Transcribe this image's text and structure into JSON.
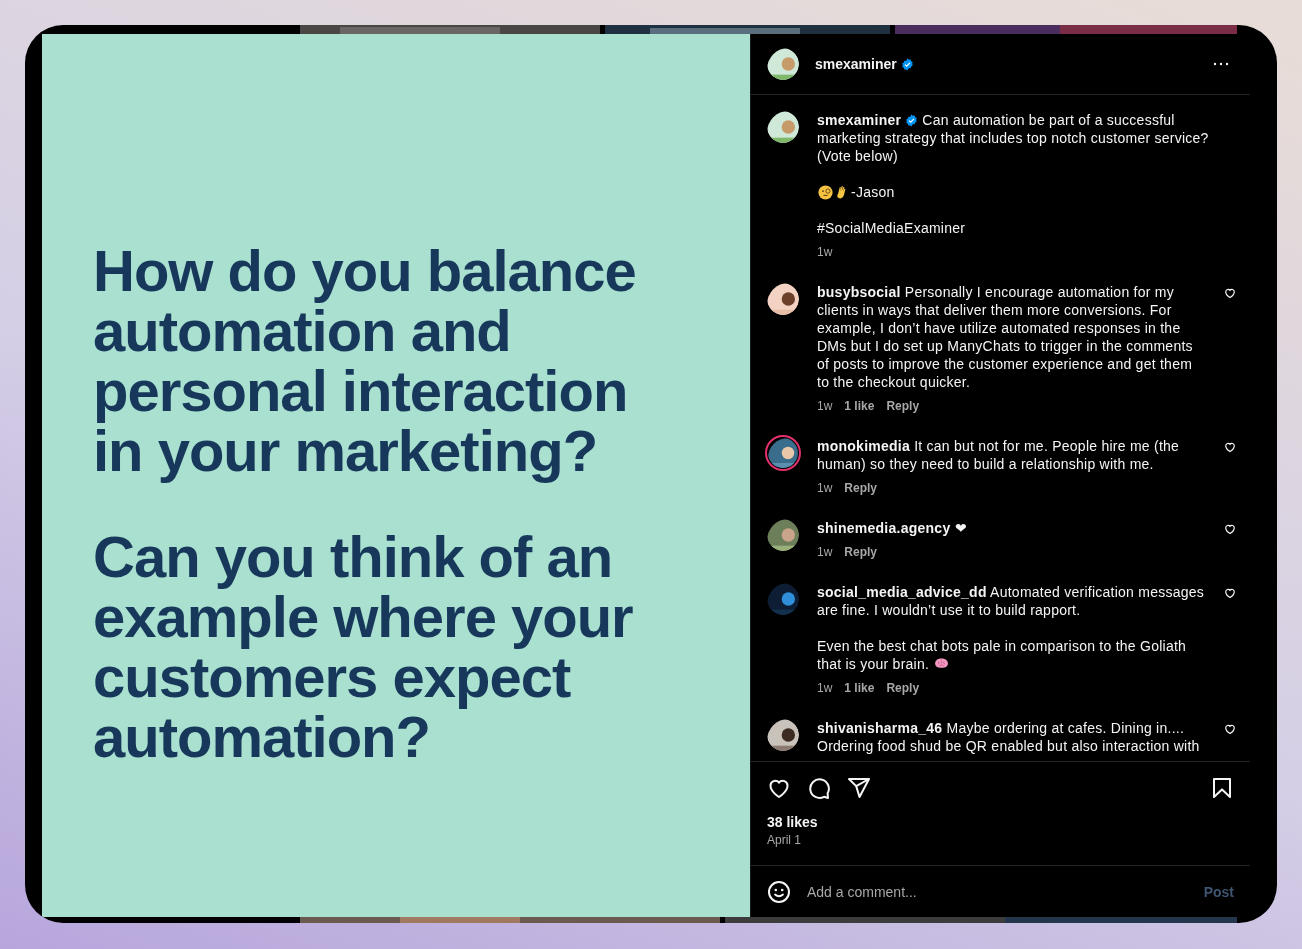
{
  "post_image": {
    "paragraphs": [
      {
        "lines": [
          "How do you balance",
          "automation and",
          "personal interaction",
          "in your marketing?"
        ]
      },
      {
        "lines": [
          "Can you think of an",
          "example where your",
          "customers expect",
          "automation?"
        ]
      }
    ]
  },
  "header": {
    "username": "smexaminer",
    "verified": true
  },
  "caption": {
    "username": "smexaminer",
    "verified": true,
    "text": "Can automation be part of a successful marketing strategy that includes top notch customer service? (Vote below)",
    "signature": "-Jason",
    "hashtag": "#SocialMediaExaminer",
    "time": "1w"
  },
  "comments": [
    {
      "username": "busybsocial",
      "paragraphs": [
        "Personally I encourage automation for my clients in ways that deliver them more conversions. For example, I don’t have utilize automated responses in the DMs but I do set up ManyChats to trigger in the comments of posts to improve the customer experience and get them to the checkout quicker."
      ],
      "time": "1w",
      "likes": "1 like",
      "reply": "Reply",
      "liked": false,
      "has_story": false
    },
    {
      "username": "monokimedia",
      "paragraphs": [
        "It can but not for me. People hire me (the human) so they need to build a relationship with me."
      ],
      "time": "1w",
      "reply": "Reply",
      "liked": false,
      "has_story": true
    },
    {
      "username": "shinemedia.agency",
      "paragraphs": [
        "❤"
      ],
      "time": "1w",
      "reply": "Reply",
      "liked": false,
      "has_story": false
    },
    {
      "username": "social_media_advice_dd",
      "paragraphs": [
        "Automated verification messages are fine. I wouldn’t use it to build rapport.",
        "Even the best chat bots pale in comparison to the Goliath that is your brain."
      ],
      "kind": "text_emoji",
      "time": "1w",
      "likes": "1 like",
      "reply": "Reply",
      "liked": false,
      "has_story": false
    },
    {
      "username": "shivanisharma_46",
      "paragraphs": [
        "Maybe ordering at cafes. Dining in.... Ordering food shud be QR enabled but also interaction with"
      ],
      "liked": false,
      "has_story": false
    }
  ],
  "actions": {
    "liked": false,
    "saved": false,
    "likes": "38 likes",
    "date": "April 1"
  },
  "comment_box": {
    "placeholder": "Add a comment...",
    "post_label": "Post",
    "disabled": true
  }
}
